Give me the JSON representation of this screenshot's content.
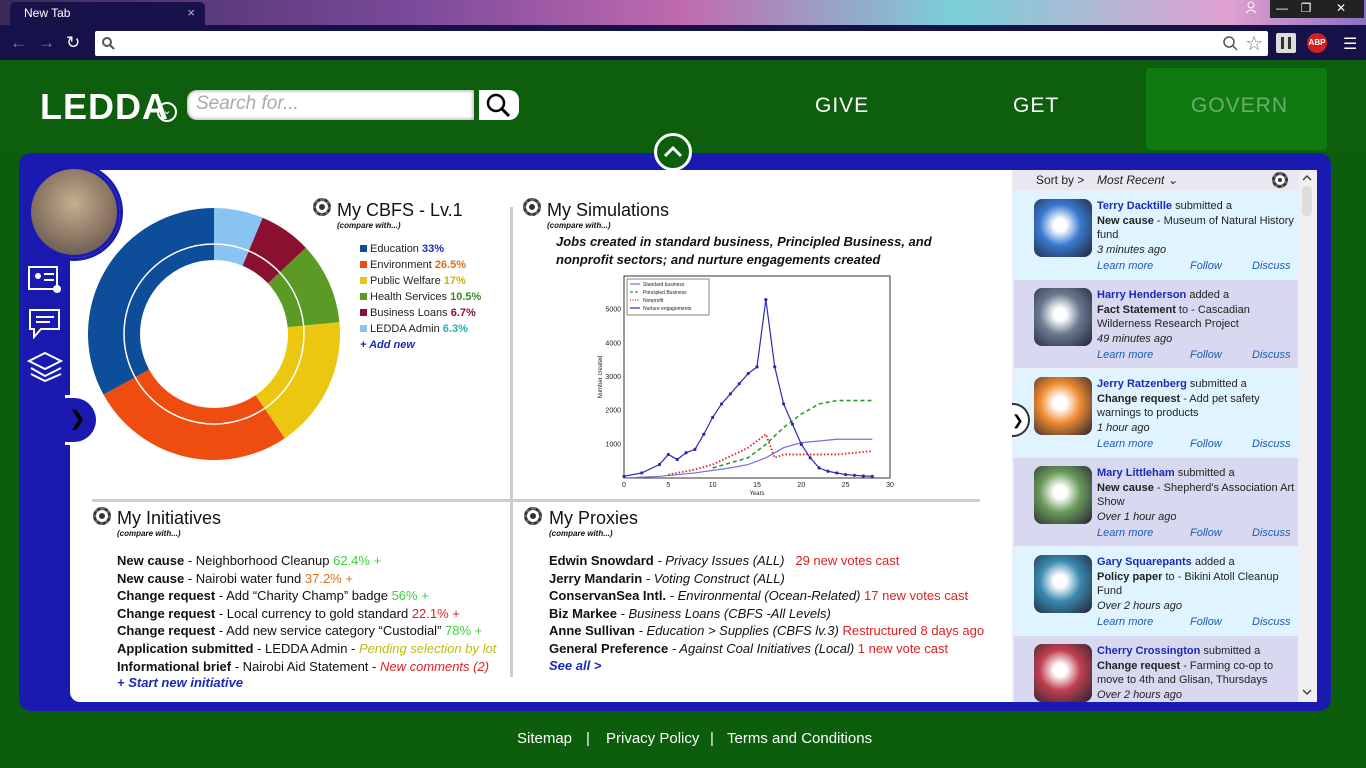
{
  "browser": {
    "tab_title": "New Tab",
    "tab_close": "×",
    "window_min": "—",
    "window_max": "❐",
    "window_close": "✕",
    "abp_label": "ABP"
  },
  "header": {
    "logo": "LEDDA",
    "search_placeholder": "Search for...",
    "nav": {
      "give": "GIVE",
      "get": "GET",
      "govern": "GOVERN"
    }
  },
  "cbfs": {
    "title": "My CBFS - Lv.1",
    "compare": "(compare with...)",
    "legend": [
      {
        "name": "Education",
        "pct": "33%",
        "color": "#0d4d9a",
        "pct_color": "#1a2ab8"
      },
      {
        "name": "Environment",
        "pct": "26.5%",
        "color": "#ef4d10",
        "pct_color": "#e07015"
      },
      {
        "name": "Public Welfare",
        "pct": "17%",
        "color": "#ecc711",
        "pct_color": "#c8b010"
      },
      {
        "name": "Health Services",
        "pct": "10.5%",
        "color": "#5a9a25",
        "pct_color": "#3a8a25"
      },
      {
        "name": "Business Loans",
        "pct": "6.7%",
        "color": "#8a1030",
        "pct_color": "#8a1030"
      },
      {
        "name": "LEDDA Admin",
        "pct": "6.3%",
        "color": "#89c3f2",
        "pct_color": "#20b0b0"
      }
    ],
    "add_new": "+ Add new",
    "donut_values": [
      33,
      26.5,
      17,
      10.5,
      6.7,
      6.3
    ]
  },
  "simulations": {
    "title": "My Simulations",
    "compare": "(compare with...)",
    "caption": "Jobs created in standard business, Principled Business, and nonprofit sectors; and nurture engagements created"
  },
  "chart_data": {
    "type": "line",
    "xlabel": "Years",
    "ylabel": "Number created",
    "xlim": [
      0,
      30
    ],
    "ylim": [
      0,
      6000
    ],
    "xticks": [
      0,
      5,
      10,
      15,
      20,
      25,
      30
    ],
    "yticks": [
      1000,
      2000,
      3000,
      4000,
      5000
    ],
    "series": [
      {
        "name": "Standard business",
        "color": "#7070e0",
        "style": "solid",
        "x": [
          0,
          4,
          8,
          12,
          14,
          16,
          18,
          20,
          22,
          24,
          26,
          28
        ],
        "y": [
          0,
          50,
          150,
          300,
          400,
          600,
          900,
          1050,
          1100,
          1150,
          1150,
          1150
        ]
      },
      {
        "name": "Principled Business",
        "color": "#2a9a2a",
        "style": "dashed",
        "x": [
          10,
          12,
          14,
          16,
          18,
          20,
          22,
          24,
          26,
          28
        ],
        "y": [
          300,
          450,
          600,
          1000,
          1500,
          1900,
          2200,
          2300,
          2300,
          2300
        ]
      },
      {
        "name": "Nonprofit",
        "color": "#e02020",
        "style": "dotted",
        "x": [
          5,
          8,
          10,
          12,
          14,
          16,
          17,
          18,
          20,
          22,
          24,
          26,
          28
        ],
        "y": [
          100,
          250,
          400,
          650,
          900,
          1300,
          600,
          700,
          700,
          700,
          700,
          750,
          800
        ]
      },
      {
        "name": "Nurture engagements",
        "color": "#2a2ab0",
        "style": "marker",
        "x": [
          0,
          2,
          4,
          5,
          6,
          7,
          8,
          9,
          10,
          11,
          12,
          13,
          14,
          15,
          16,
          17,
          18,
          19,
          20,
          21,
          22,
          23,
          24,
          25,
          26,
          27,
          28
        ],
        "y": [
          50,
          150,
          400,
          700,
          550,
          750,
          850,
          1300,
          1800,
          2200,
          2500,
          2800,
          3100,
          3300,
          5300,
          3300,
          2200,
          1600,
          1000,
          600,
          300,
          200,
          150,
          100,
          80,
          60,
          50
        ]
      }
    ]
  },
  "initiatives": {
    "title": "My Initiatives",
    "compare": "(compare with...)",
    "items": [
      {
        "type": "New cause",
        "desc": " - Neighborhood Cleanup ",
        "status": "62.4% +",
        "status_class": "green"
      },
      {
        "type": "New cause",
        "desc": " - Nairobi water fund ",
        "status": "37.2% +",
        "status_class": "orange"
      },
      {
        "type": "Change request",
        "desc": " - Add “Charity Champ” badge ",
        "status": "56% +",
        "status_class": "green"
      },
      {
        "type": "Change request",
        "desc": " - Local currency to gold standard ",
        "status": "22.1% +",
        "status_class": "red"
      },
      {
        "type": "Change request",
        "desc": " - Add new service category “Custodial” ",
        "status": "78% +",
        "status_class": "green"
      },
      {
        "type": "Application submitted",
        "desc": " - LEDDA Admin - ",
        "status": "Pending selection by lot",
        "status_class": "yellow"
      },
      {
        "type": "Informational brief",
        "desc": " - Nairobi Aid Statement - ",
        "status": "New comments (2)",
        "status_class": "red i"
      }
    ],
    "start_new": "+ Start new initiative"
  },
  "proxies": {
    "title": "My Proxies",
    "compare": "(compare with...)",
    "items": [
      {
        "name": "Edwin Snowdard",
        "scope": " - Privacy Issues (ALL)",
        "status": "   29 new votes cast"
      },
      {
        "name": "Jerry Mandarin",
        "scope": " - Voting Construct (ALL)",
        "status": ""
      },
      {
        "name": "ConservanSea Intl.",
        "scope": " - Environmental (Ocean-Related)",
        "status": " 17 new votes cast"
      },
      {
        "name": "Biz Markee",
        "scope": " - Business Loans (CBFS -All Levels)",
        "status": ""
      },
      {
        "name": "Anne Sullivan",
        "scope": " - Education > Supplies (CBFS lv.3)",
        "status": " Restructured 8 days ago"
      },
      {
        "name": "General Preference",
        "scope": " - Against Coal Initiatives (Local)",
        "status": " 1 new vote cast"
      }
    ],
    "see_all": "See all >"
  },
  "feed": {
    "sort_label": "Sort by >",
    "sort_value": "Most Recent",
    "actions": {
      "learn": "Learn more",
      "follow": "Follow",
      "discuss": "Discuss"
    },
    "items": [
      {
        "who": "Terry Dacktille",
        "verb": " submitted a",
        "kind": "New cause",
        "rest": " - Museum of Natural History fund",
        "time": "3 minutes ago",
        "bg": "#e0f4ff",
        "thumb": "#3a7ad0"
      },
      {
        "who": "Harry Henderson",
        "verb": " added a",
        "kind": "Fact Statement",
        "rest": " to - Cascadian Wilderness Research Project",
        "time": "49 minutes ago",
        "bg": "#d8d8f0",
        "thumb": "#6a7a90"
      },
      {
        "who": "Jerry Ratzenberg",
        "verb": " submitted a",
        "kind": "Change request",
        "rest": " - Add pet safety warnings to products",
        "time": "1 hour ago",
        "bg": "#e0f4ff",
        "thumb": "#f08a30"
      },
      {
        "who": "Mary Littleham",
        "verb": " submitted a",
        "kind": "New cause",
        "rest": " - Shepherd's Association Art Show",
        "time": "Over 1 hour ago",
        "bg": "#d8d8f0",
        "thumb": "#6a9a5a"
      },
      {
        "who": "Gary Squarepants",
        "verb": " added a",
        "kind": "Policy paper",
        "rest": " to - Bikini Atoll Cleanup Fund",
        "time": "Over 2 hours ago",
        "bg": "#e0f4ff",
        "thumb": "#3a8ab0"
      },
      {
        "who": "Cherry Crossington",
        "verb": " submitted a",
        "kind": "Change request",
        "rest": " - Farming co-op to move to 4th and Glisan, Thursdays",
        "time": "Over 2 hours ago",
        "bg": "#d8d8f0",
        "thumb": "#c04050"
      }
    ]
  },
  "footer": {
    "sitemap": "Sitemap",
    "sep1": "|",
    "privacy": "Privacy Policy",
    "sep2": "|",
    "terms": "Terms and Conditions"
  }
}
